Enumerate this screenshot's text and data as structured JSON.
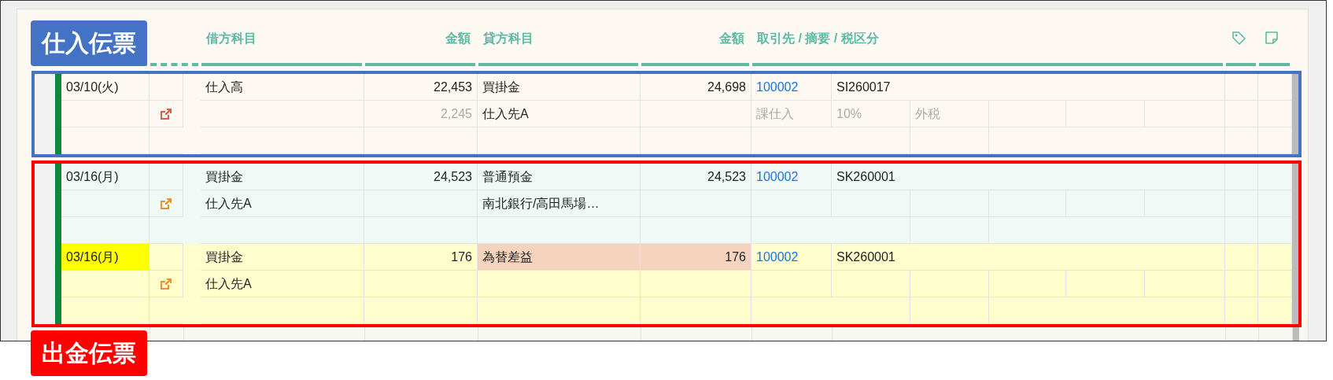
{
  "columns": [
    {
      "label": "借方科目",
      "kind": "text"
    },
    {
      "label": "金額",
      "kind": "amount"
    },
    {
      "label": "貸方科目",
      "kind": "text"
    },
    {
      "label": "金額",
      "kind": "amount"
    },
    {
      "label": "取引先 / 摘要 / 税区分",
      "kind": "text"
    }
  ],
  "vouchers": [
    {
      "label": "仕入伝票",
      "color": "#4472c4",
      "entries": [
        {
          "color": "#fdf9f2",
          "date": "03/10(火)",
          "date_highlighted": false,
          "edit_icon": {
            "color": "#e05a4a"
          },
          "debit": "仕入高",
          "debit_amount": "22,453",
          "credit": "買掛金",
          "credit_amount": "24,698",
          "credit_highlighted": false,
          "partner_code": "100002",
          "memo": "SI260017",
          "tax_amount": "2,245",
          "credit_sub": "仕入先A",
          "tax": [
            "課仕入",
            "10%",
            "外税"
          ]
        }
      ]
    },
    {
      "label": "出金伝票",
      "color": "#ff0000",
      "entries": [
        {
          "color": "#f1f9f6",
          "date": "03/16(月)",
          "date_highlighted": false,
          "edit_icon": {
            "color": "#f0902a"
          },
          "debit": "買掛金",
          "debit_amount": "24,523",
          "credit": "普通預金",
          "credit_amount": "24,523",
          "credit_highlighted": false,
          "partner_code": "100002",
          "memo": "SK260001",
          "debit_sub": "仕入先A",
          "credit_sub": "南北銀行/高田馬場…"
        },
        {
          "color": "#fefdcc",
          "date": "03/16(月)",
          "date_highlighted": true,
          "edit_icon": {
            "color": "#f0902a"
          },
          "debit": "買掛金",
          "debit_amount": "176",
          "credit": "為替差益",
          "credit_amount": "176",
          "credit_highlighted": true,
          "partner_code": "100002",
          "memo": "SK260001",
          "debit_sub": "仕入先A"
        }
      ]
    }
  ]
}
